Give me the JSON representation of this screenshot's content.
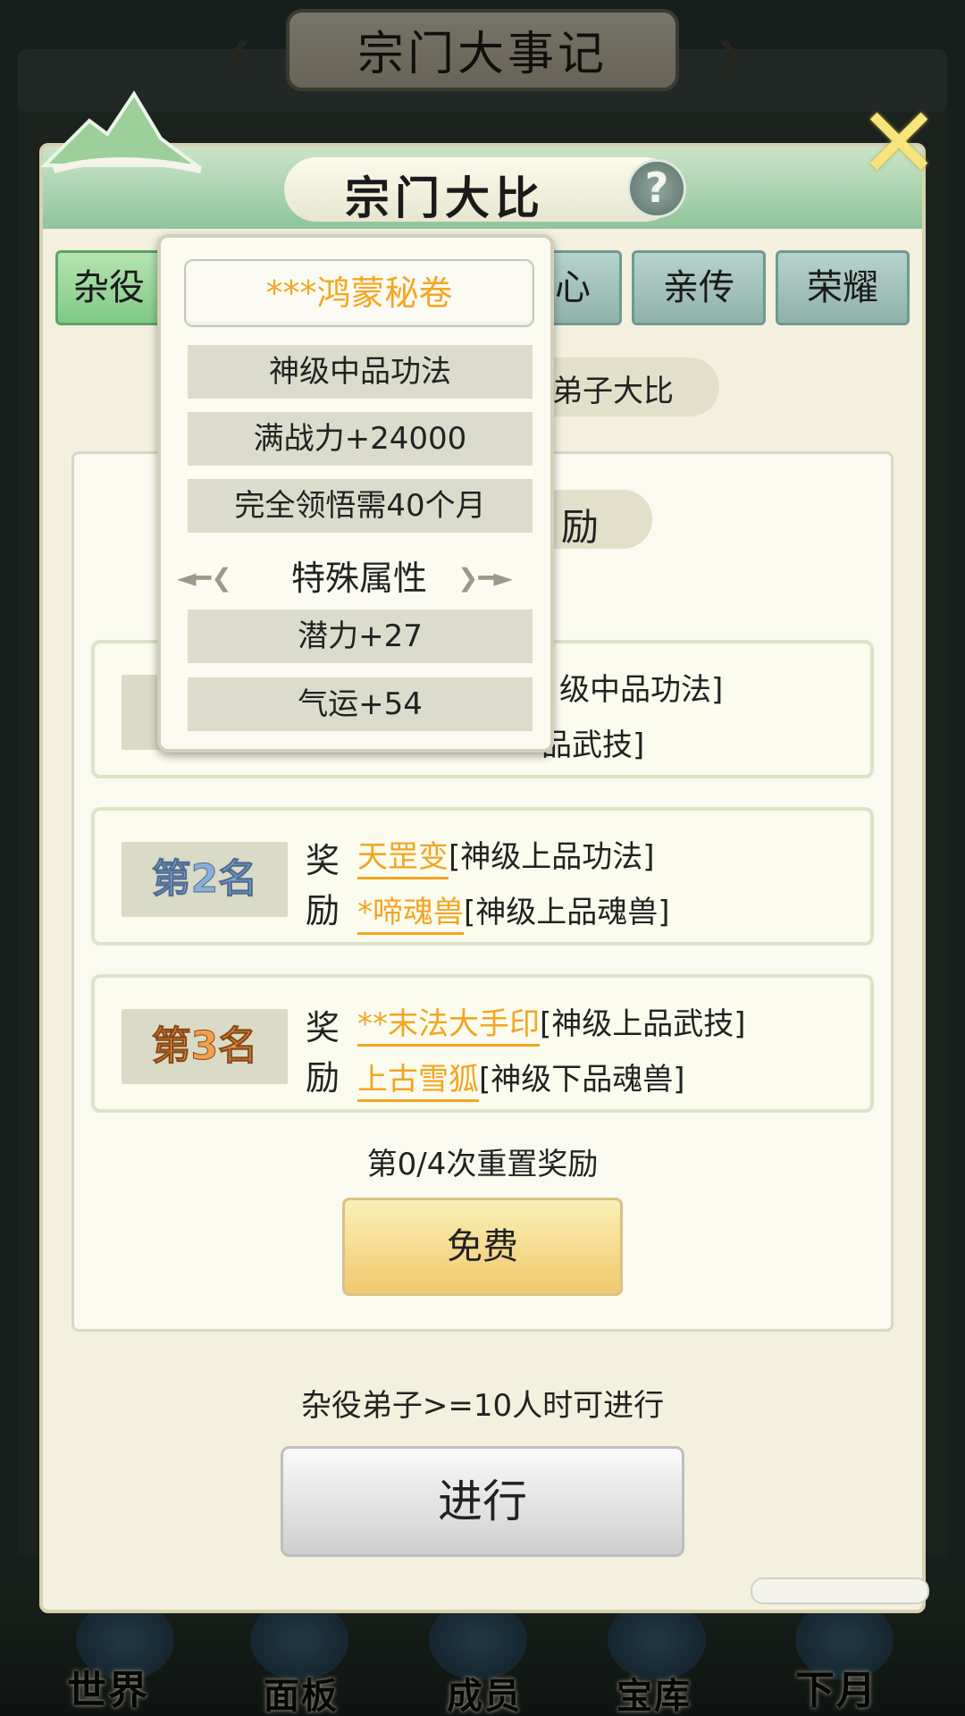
{
  "background": {
    "title": "宗门大事记",
    "nav": [
      {
        "label": "世界"
      },
      {
        "label": "面板"
      },
      {
        "label": "成员"
      },
      {
        "label": "宝库"
      },
      {
        "label": "下月"
      }
    ]
  },
  "modal": {
    "title": "宗门大比",
    "help_symbol": "?",
    "close_symbol": "✕",
    "tabs": [
      {
        "label": "杂役",
        "active": true
      },
      {
        "label": "心",
        "active": false
      },
      {
        "label": "亲传",
        "active": false
      },
      {
        "label": "荣耀",
        "active": false
      }
    ],
    "subtitle": "弟子大比",
    "reward_heading": "励",
    "ranks": [
      {
        "badge": "",
        "reward_word": "",
        "items": [
          {
            "name": "",
            "grade": "级中品功法]"
          },
          {
            "name": "",
            "grade": "品武技]"
          }
        ]
      },
      {
        "badge": "第2名",
        "reward_word": "奖励",
        "items": [
          {
            "name": "天罡变",
            "grade": "[神级上品功法]"
          },
          {
            "name": "*啼魂兽",
            "grade": "[神级上品魂兽]"
          }
        ]
      },
      {
        "badge": "第3名",
        "reward_word": "奖励",
        "items": [
          {
            "name": "**末法大手印",
            "grade": "[神级上品武技]"
          },
          {
            "name": "上古雪狐",
            "grade": "[神级下品魂兽]"
          }
        ]
      }
    ],
    "reset_text": "第0/4次重置奖励",
    "free_button": "免费",
    "condition_text": "杂役弟子>=10人时可进行",
    "go_button": "进行"
  },
  "tooltip": {
    "title": "***鸿蒙秘卷",
    "rows": [
      "神级中品功法",
      "满战力+24000",
      "完全领悟需40个月"
    ],
    "section_title": "特殊属性",
    "special_rows": [
      "潜力+27",
      "气运+54"
    ]
  },
  "colors": {
    "item_name": "#f2a521",
    "tooltip_title": "#f5a622",
    "header_green": "#8fc49a",
    "active_tab": "#7fca86"
  }
}
